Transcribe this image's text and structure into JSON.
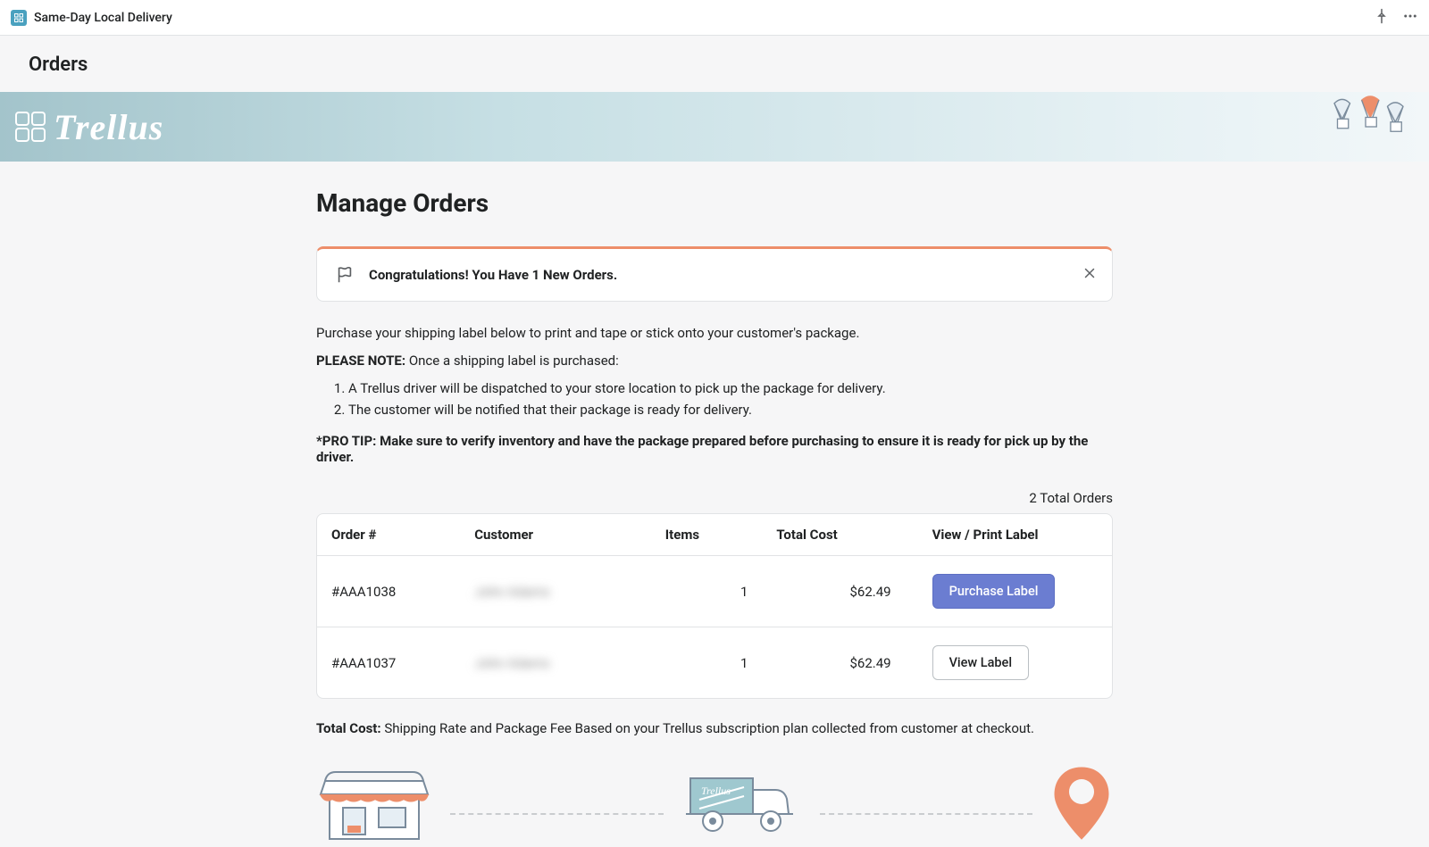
{
  "topbar": {
    "app_title": "Same-Day Local Delivery"
  },
  "page": {
    "title": "Orders"
  },
  "banner": {
    "brand_name": "Trellus"
  },
  "main": {
    "heading": "Manage Orders",
    "alert": {
      "text": "Congratulations! You Have 1 New Orders."
    },
    "info_line1": "Purchase your shipping label below to print and tape or stick onto your customer's package.",
    "info_note_label": "PLEASE NOTE:",
    "info_note_text": " Once a shipping label is purchased:",
    "info_list": {
      "item1": "A Trellus driver will be dispatched to your store location to pick up the package for delivery.",
      "item2": "The customer will be notified that their package is ready for delivery."
    },
    "pro_tip": "*PRO TIP: Make sure to verify inventory and have the package prepared before purchasing to ensure it is ready for pick up by the driver.",
    "total_orders": "2 Total Orders",
    "table": {
      "headers": {
        "order": "Order #",
        "customer": "Customer",
        "items": "Items",
        "cost": "Total Cost",
        "action": "View / Print Label"
      },
      "rows": [
        {
          "order": "#AAA1038",
          "customer": "John Adams",
          "items": "1",
          "cost": "$62.49",
          "action_label": "Purchase Label",
          "action_type": "primary"
        },
        {
          "order": "#AAA1037",
          "customer": "John Adams",
          "items": "1",
          "cost": "$62.49",
          "action_label": "View Label",
          "action_type": "secondary"
        }
      ]
    },
    "footer_note_label": "Total Cost:",
    "footer_note_text": " Shipping Rate and Package Fee Based on your Trellus subscription plan collected from customer at checkout."
  }
}
